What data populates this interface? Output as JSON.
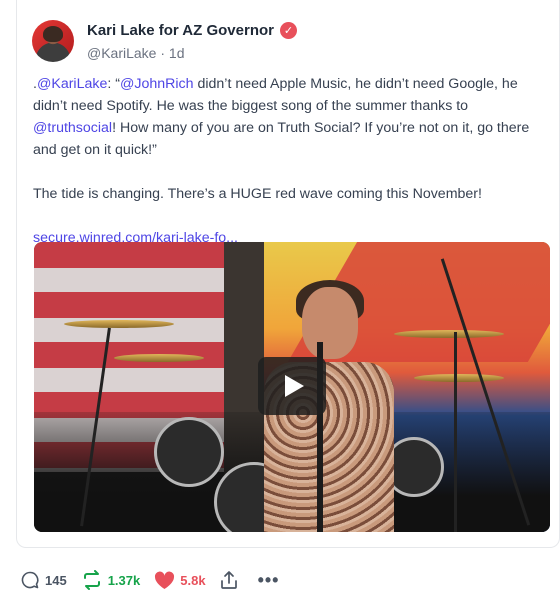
{
  "post": {
    "author": {
      "display_name": "Kari Lake for AZ Governor",
      "handle": "@KariLake",
      "separator": "·",
      "age": "1d",
      "verified_icon": "verified-badge-icon"
    },
    "text": {
      "p1_prefix": ".",
      "p1_mention1": "@KariLake",
      "p1_part2": ": “",
      "p1_mention2": "@JohnRich",
      "p1_part3": " didn’t need Apple Music, he didn’t need Google, he didn’t need Spotify. He was the biggest song of the summer thanks to ",
      "p1_mention3": "@truthsocial",
      "p1_part4": "! How many of you are on Truth Social? If you’re not on it, go there and get on it quick!”",
      "p2": "The tide is changing. There’s a HUGE red wave coming this November!",
      "link": "secure.winred.com/kari-lake-fo..."
    },
    "media": {
      "type": "video",
      "play_icon": "play-icon"
    },
    "stats": {
      "replies": "145",
      "retruths": "1.37k",
      "likes": "5.8k"
    },
    "colors": {
      "accent": "#4f46e5",
      "retruth": "#16a34a",
      "like": "#e8505b"
    }
  }
}
